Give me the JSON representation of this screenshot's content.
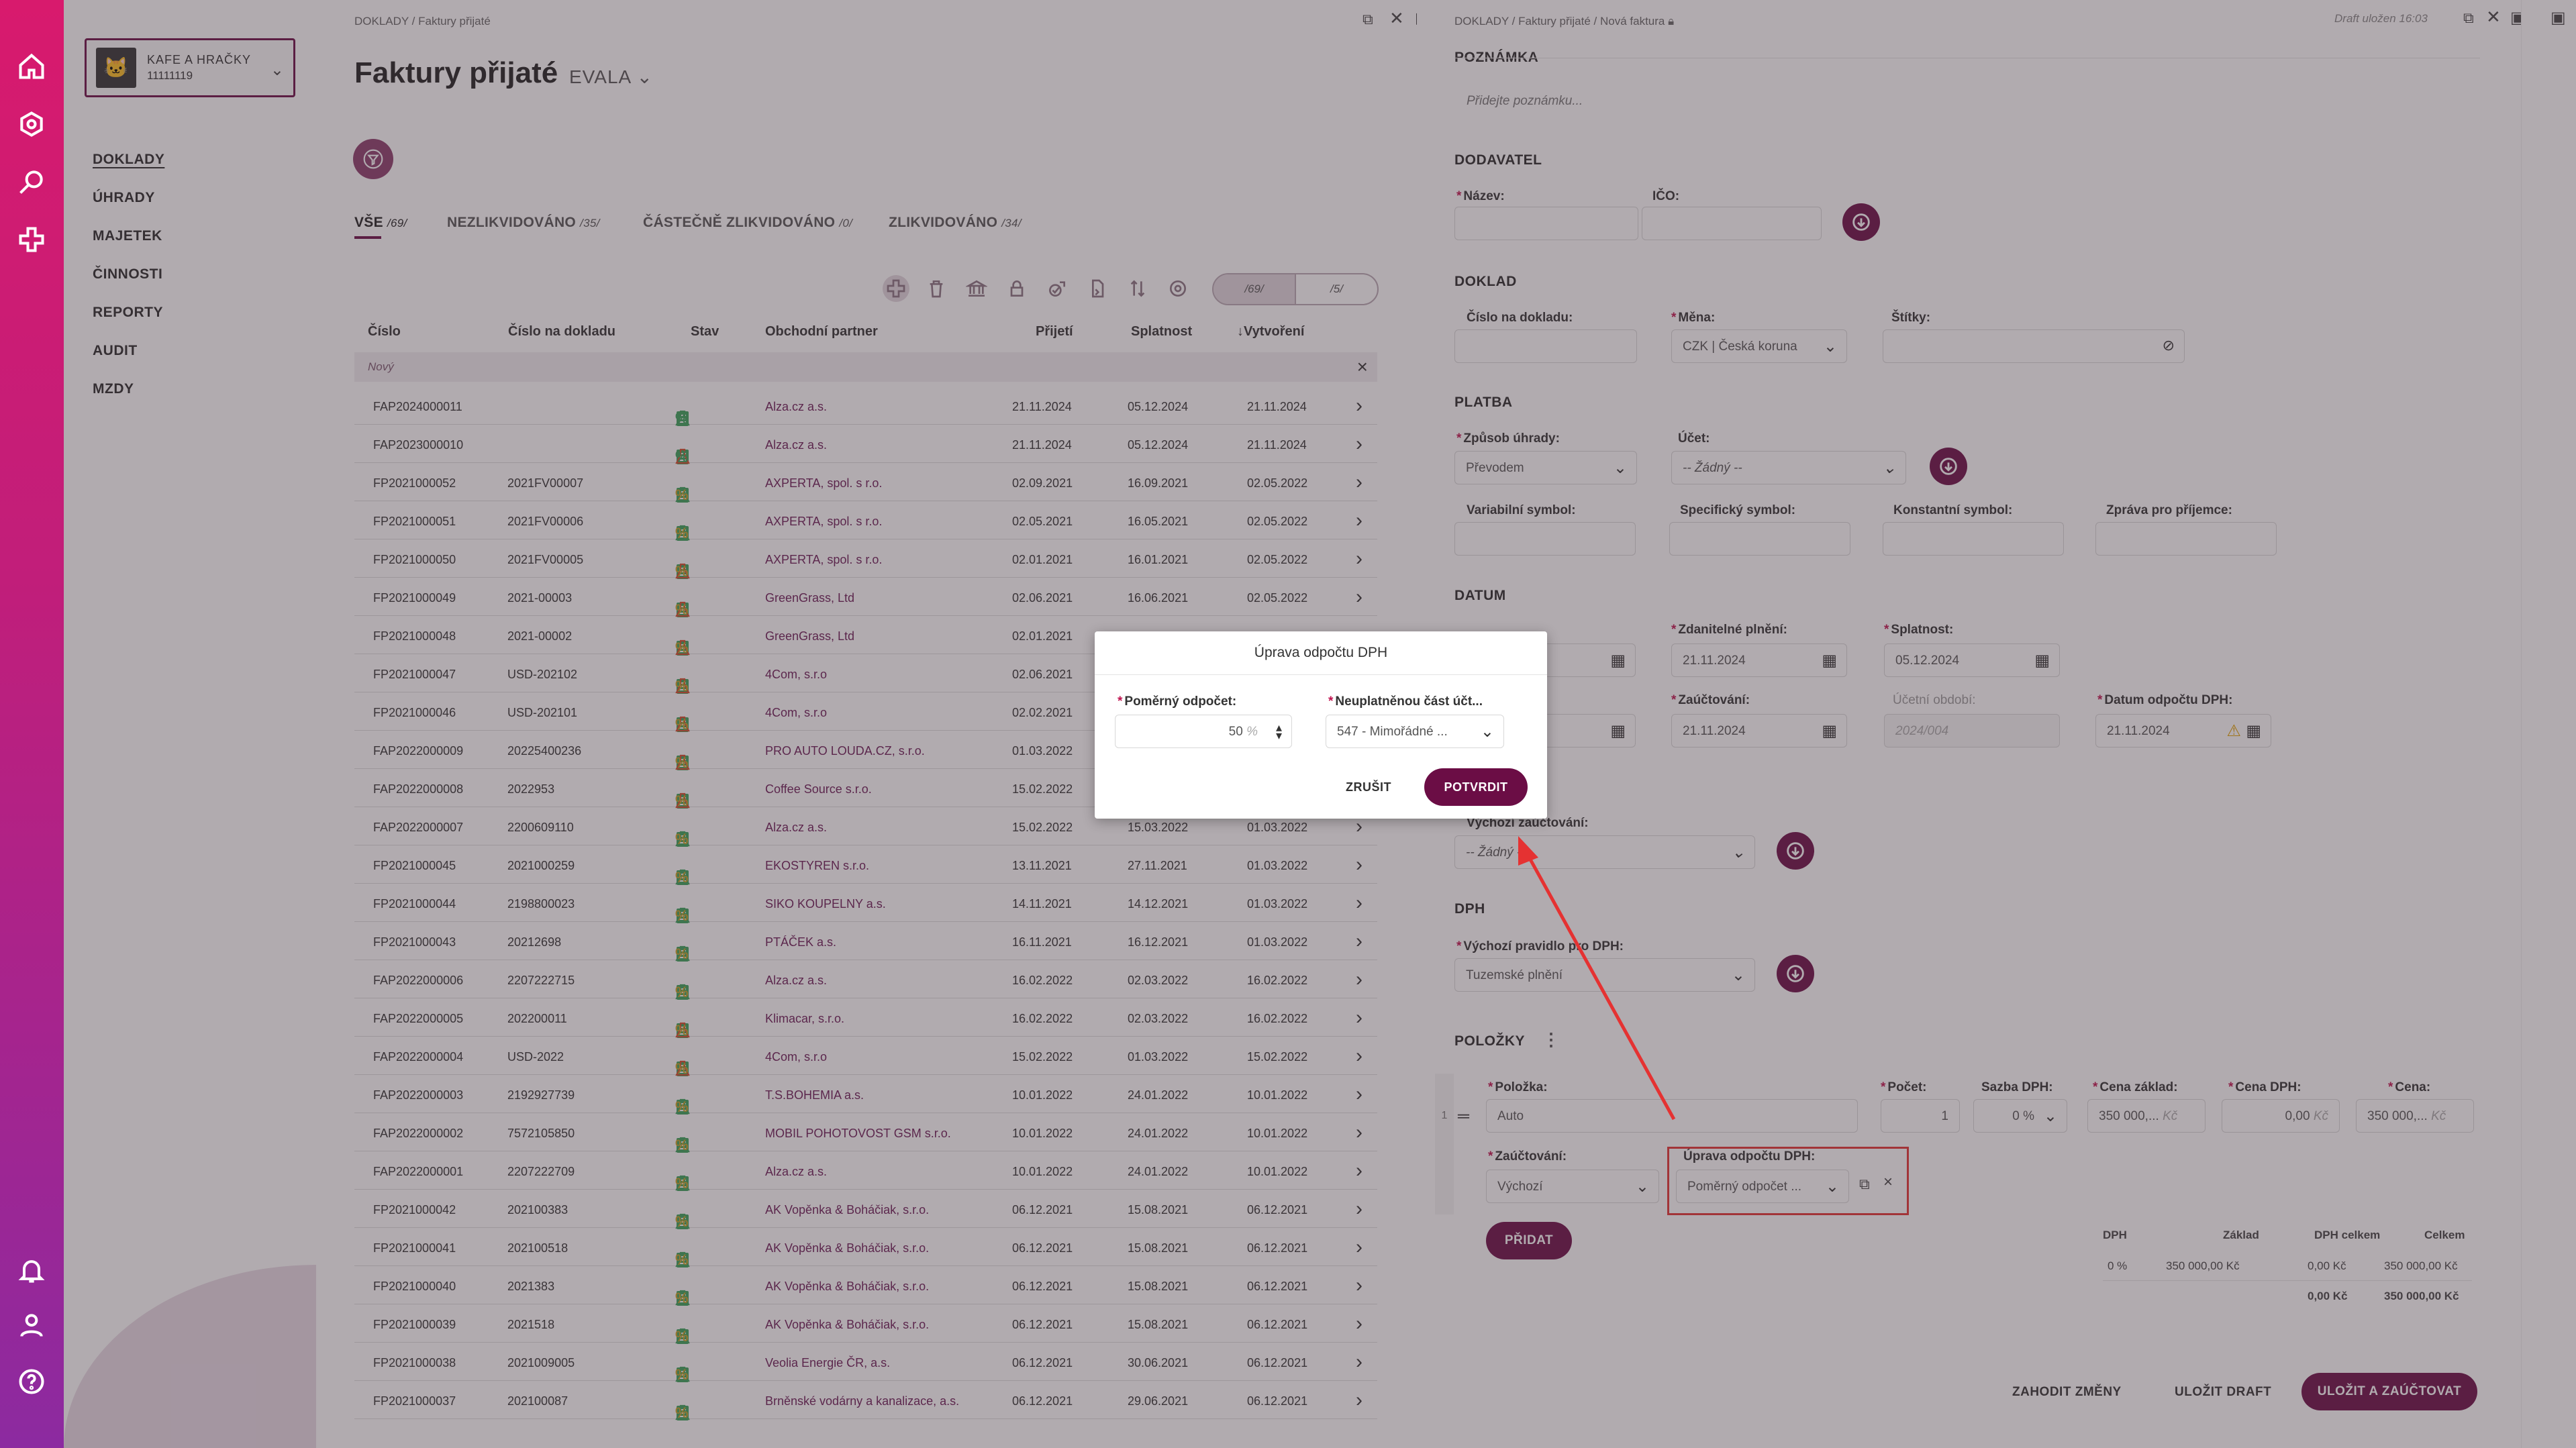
{
  "company": {
    "name": "KAFE A HRAČKY",
    "id": "11111119"
  },
  "nav": {
    "items": [
      "DOKLADY",
      "ÚHRADY",
      "MAJETEK",
      "ČINNOSTI",
      "REPORTY",
      "AUDIT",
      "MZDY"
    ]
  },
  "left": {
    "breadcrumb": "DOKLADY  /  Faktury přijaté",
    "title": "Faktury přijaté",
    "subtitle": "EVALA",
    "tabs": [
      {
        "label": "VŠE",
        "count": "/69/"
      },
      {
        "label": "NEZLIKVIDOVÁNO",
        "count": "/35/"
      },
      {
        "label": "ČÁSTEČNĚ ZLIKVIDOVÁNO",
        "count": "/0/"
      },
      {
        "label": "ZLIKVIDOVÁNO",
        "count": "/34/"
      }
    ],
    "seg": [
      "/69/",
      "/5/"
    ],
    "columns": [
      "Číslo",
      "Číslo na dokladu",
      "Stav",
      "Obchodní partner",
      "Přijetí",
      "Splatnost",
      "Vytvoření"
    ],
    "new_row": "Nový",
    "rows": [
      [
        "FAP2024000011",
        "",
        "Alza.cz a.s.",
        "21.11.2024",
        "05.12.2024",
        "21.11.2024"
      ],
      [
        "FAP2023000010",
        "",
        "Alza.cz a.s.",
        "21.11.2024",
        "05.12.2024",
        "21.11.2024"
      ],
      [
        "FP2021000052",
        "2021FV00007",
        "AXPERTA, spol. s r.o.",
        "02.09.2021",
        "16.09.2021",
        "02.05.2022"
      ],
      [
        "FP2021000051",
        "2021FV00006",
        "AXPERTA, spol. s r.o.",
        "02.05.2021",
        "16.05.2021",
        "02.05.2022"
      ],
      [
        "FP2021000050",
        "2021FV00005",
        "AXPERTA, spol. s r.o.",
        "02.01.2021",
        "16.01.2021",
        "02.05.2022"
      ],
      [
        "FP2021000049",
        "2021-00003",
        "GreenGrass, Ltd",
        "02.06.2021",
        "16.06.2021",
        "02.05.2022"
      ],
      [
        "FP2021000048",
        "2021-00002",
        "GreenGrass, Ltd",
        "02.01.2021",
        "",
        ""
      ],
      [
        "FP2021000047",
        "USD-202102",
        "4Com, s.r.o",
        "02.06.2021",
        "",
        ""
      ],
      [
        "FP2021000046",
        "USD-202101",
        "4Com, s.r.o",
        "02.02.2021",
        "",
        ""
      ],
      [
        "FAP2022000009",
        "20225400236",
        "PRO AUTO LOUDA.CZ, s.r.o.",
        "01.03.2022",
        "",
        ""
      ],
      [
        "FAP2022000008",
        "2022953",
        "Coffee Source s.r.o.",
        "15.02.2022",
        "",
        ""
      ],
      [
        "FAP2022000007",
        "2200609110",
        "Alza.cz a.s.",
        "15.02.2022",
        "15.03.2022",
        "01.03.2022"
      ],
      [
        "FP2021000045",
        "2021000259",
        "EKOSTYREN s.r.o.",
        "13.11.2021",
        "27.11.2021",
        "01.03.2022"
      ],
      [
        "FP2021000044",
        "2198800023",
        "SIKO KOUPELNY a.s.",
        "14.11.2021",
        "14.12.2021",
        "01.03.2022"
      ],
      [
        "FP2021000043",
        "20212698",
        "PTÁČEK a.s.",
        "16.11.2021",
        "16.12.2021",
        "01.03.2022"
      ],
      [
        "FAP2022000006",
        "2207222715",
        "Alza.cz a.s.",
        "16.02.2022",
        "02.03.2022",
        "16.02.2022"
      ],
      [
        "FAP2022000005",
        "202200011",
        "Klimacar, s.r.o.",
        "16.02.2022",
        "02.03.2022",
        "16.02.2022"
      ],
      [
        "FAP2022000004",
        "USD-2022",
        "4Com, s.r.o",
        "15.02.2022",
        "01.03.2022",
        "15.02.2022"
      ],
      [
        "FAP2022000003",
        "2192927739",
        "T.S.BOHEMIA a.s.",
        "10.01.2022",
        "24.01.2022",
        "10.01.2022"
      ],
      [
        "FAP2022000002",
        "7572105850",
        "MOBIL POHOTOVOST GSM s.r.o.",
        "10.01.2022",
        "24.01.2022",
        "10.01.2022"
      ],
      [
        "FAP2022000001",
        "2207222709",
        "Alza.cz a.s.",
        "10.01.2022",
        "24.01.2022",
        "10.01.2022"
      ],
      [
        "FP2021000042",
        "202100383",
        "AK Vopěnka & Boháčiak, s.r.o.",
        "06.12.2021",
        "15.08.2021",
        "06.12.2021"
      ],
      [
        "FP2021000041",
        "202100518",
        "AK Vopěnka & Boháčiak, s.r.o.",
        "06.12.2021",
        "15.08.2021",
        "06.12.2021"
      ],
      [
        "FP2021000040",
        "2021383",
        "AK Vopěnka & Boháčiak, s.r.o.",
        "06.12.2021",
        "15.08.2021",
        "06.12.2021"
      ],
      [
        "FP2021000039",
        "2021518",
        "AK Vopěnka & Boháčiak, s.r.o.",
        "06.12.2021",
        "15.08.2021",
        "06.12.2021"
      ],
      [
        "FP2021000038",
        "2021009005",
        "Veolia Energie ČR, a.s.",
        "06.12.2021",
        "30.06.2021",
        "06.12.2021"
      ],
      [
        "FP2021000037",
        "202100087",
        "Brněnské vodárny a kanalizace, a.s.",
        "06.12.2021",
        "29.06.2021",
        "06.12.2021"
      ]
    ]
  },
  "right": {
    "breadcrumb": "DOKLADY  /  Faktury přijaté  /  Nová faktura",
    "draft": "Draft uložen 16:03",
    "poznamka": {
      "title": "POZNÁMKA",
      "placeholder": "Přidejte poznámku..."
    },
    "dodavatel": {
      "title": "DODAVATEL",
      "nazev": "Název:",
      "ico": "IČO:"
    },
    "doklad": {
      "title": "DOKLAD",
      "cislo": "Číslo na dokladu:",
      "mena": "Měna:",
      "mena_val": "CZK | Česká koruna",
      "stitky": "Štítky:"
    },
    "platba": {
      "title": "PLATBA",
      "zpusob": "Způsob úhrady:",
      "zpusob_val": "Převodem",
      "ucet": "Účet:",
      "ucet_val": "-- Žádný --",
      "vs": "Variabilní symbol:",
      "ss": "Specifický symbol:",
      "ks": "Konstantní symbol:",
      "zprava": "Zpráva pro příjemce:"
    },
    "datum": {
      "title": "DATUM",
      "zdanitelne": "Zdanitelné plnění:",
      "zdanitelne_val": "21.11.2024",
      "splatnost": "Splatnost:",
      "splatnost_val": "05.12.2024",
      "zauct": "Zaúčtování:",
      "zauct_val": "21.11.2024",
      "obdobi": "Účetní období:",
      "obdobi_val": "2024/004",
      "odpocet": "Datum odpočtu DPH:",
      "odpocet_val": "21.11.2024"
    },
    "vychozi": {
      "label": "Výchozí zaúčtování:",
      "val": "-- Žádný --"
    },
    "dph": {
      "title": "DPH",
      "label": "Výchozí pravidlo pro DPH:",
      "val": "Tuzemské plnění"
    },
    "polozky": {
      "title": "POLOŽKY",
      "polozka": "Položka:",
      "polozka_val": "Auto",
      "pocet": "Počet:",
      "pocet_val": "1",
      "sazba": "Sazba DPH:",
      "sazba_val": "0 %",
      "cena_zaklad": "Cena základ:",
      "cena_zaklad_val": "350 000,...",
      "currency": "Kč",
      "cena_dph": "Cena DPH:",
      "cena_dph_val": "0,00",
      "cena": "Cena:",
      "cena_val": "350 000,...",
      "zauct": "Zaúčtování:",
      "zauct_val": "Výchozí",
      "uprava": "Úprava odpočtu DPH:",
      "uprava_val": "Poměrný odpočet ...",
      "pridat": "PŘIDAT",
      "row_index": "1"
    },
    "summary": {
      "headers": [
        "DPH",
        "Základ",
        "DPH celkem",
        "Celkem"
      ],
      "row": [
        "0 %",
        "350 000,00 Kč",
        "0,00 Kč",
        "350 000,00 Kč"
      ],
      "total": [
        "0,00 Kč",
        "350 000,00 Kč"
      ]
    },
    "actions": {
      "discard": "ZAHODIT ZMĚNY",
      "save_draft": "ULOŽIT DRAFT",
      "save_post": "ULOŽIT A ZAÚČTOVAT"
    }
  },
  "modal": {
    "title": "Úprava odpočtu DPH",
    "pomerny_label": "Poměrný odpočet:",
    "pomerny_val": "50",
    "pomerny_unit": "%",
    "neuplat_label": "Neuplatněnou část účt...",
    "neuplat_val": "547 - Mimořádné ...",
    "cancel": "ZRUŠIT",
    "confirm": "POTVRDIT"
  },
  "colors": {
    "brand": "#6b0d45",
    "sidebar_top": "#d81a6d",
    "sidebar_bottom": "#8c2aa0",
    "required": "#c0134f",
    "highlight": "#e53232"
  }
}
